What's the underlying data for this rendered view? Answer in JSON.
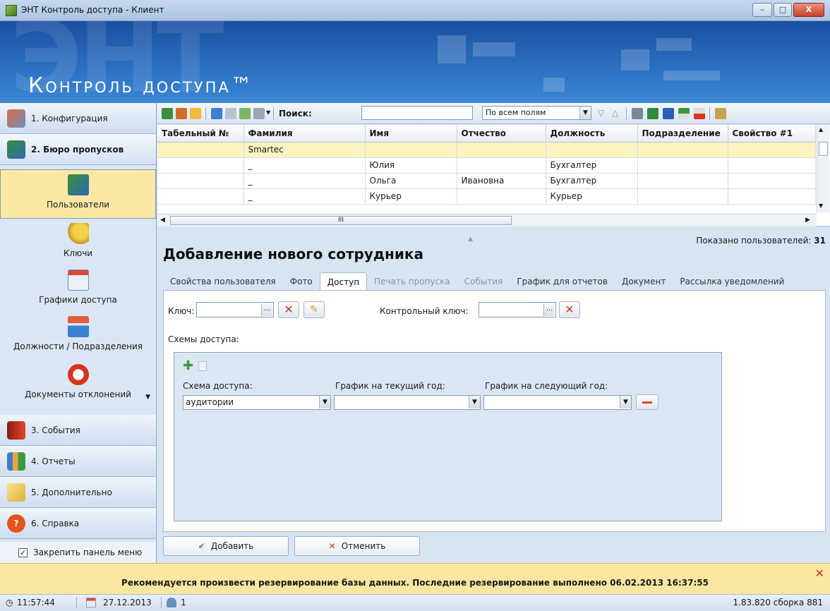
{
  "window": {
    "title": "ЭНТ Контроль доступа - Клиент",
    "minimize": "–",
    "maximize": "□",
    "close": "X"
  },
  "banner": {
    "watermark": "ЭНТ",
    "brand": "Контроль доступа™"
  },
  "sidebar": {
    "items": [
      {
        "label": "1. Конфигурация"
      },
      {
        "label": "2. Бюро пропусков"
      },
      {
        "label": "3. События"
      },
      {
        "label": "4. Отчеты"
      },
      {
        "label": "5. Дополнительно"
      },
      {
        "label": "6. Справка"
      }
    ],
    "subitems": [
      {
        "label": "Пользователи"
      },
      {
        "label": "Ключи"
      },
      {
        "label": "Графики доступа"
      },
      {
        "label": "Должности / Подразделения"
      },
      {
        "label": "Документы отклонений"
      }
    ],
    "pin_label": "Закрепить панель меню",
    "pin_checked": true
  },
  "toolbar": {
    "search_label": "Поиск:",
    "search_value": "",
    "field_select": "По всем полям"
  },
  "grid": {
    "columns": [
      "Табельный №",
      "Фамилия",
      "Имя",
      "Отчество",
      "Должность",
      "Подразделение",
      "Свойство #1"
    ],
    "rows": [
      [
        "",
        "Smartec",
        "",
        "",
        "",
        "",
        ""
      ],
      [
        "",
        "_",
        "Юлия",
        "",
        "Бухгалтер",
        "",
        ""
      ],
      [
        "",
        "_",
        "Ольга",
        "Ивановна",
        "Бухгалтер",
        "",
        ""
      ],
      [
        "",
        "_",
        "Курьер",
        "",
        "Курьер",
        "",
        ""
      ]
    ],
    "scroll_mark": "III"
  },
  "detail": {
    "shown_label": "Показано пользователей:",
    "shown_count": "31",
    "title": "Добавление нового сотрудника",
    "tabs": [
      "Свойства пользователя",
      "Фото",
      "Доступ",
      "Печать пропуска",
      "События",
      "График для отчетов",
      "Документ",
      "Рассылка уведомлений"
    ],
    "active_tab": "Доступ",
    "key_label": "Ключ:",
    "key_value": "",
    "control_key_label": "Контрольный ключ:",
    "control_key_value": "",
    "schemes_label": "Схемы доступа:",
    "scheme_col": "Схема доступа:",
    "cur_year_col": "График на текущий год:",
    "next_year_col": "График на следующий год:",
    "scheme_value": "аудитории",
    "cur_year_value": "",
    "next_year_value": "",
    "add_button": "Добавить",
    "cancel_button": "Отменить"
  },
  "notice": {
    "text": "Рекомендуется произвести резервирование базы данных. Последние резервирование выполнено 06.02.2013 16:37:55"
  },
  "status": {
    "time": "11:57:44",
    "date": "27.12.2013",
    "users": "1",
    "version": "1.83.820 сборка 881"
  },
  "colors": {
    "accent": "#2f78c9",
    "highlight": "#fbf3c0",
    "notice": "#f9e6a0",
    "danger": "#d8341c"
  }
}
